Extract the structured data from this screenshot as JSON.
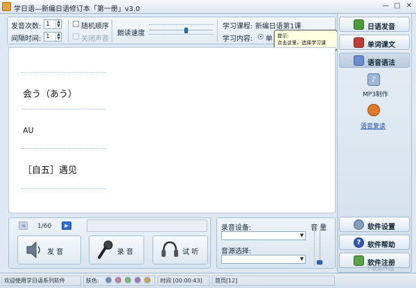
{
  "window": {
    "title": "学日语—新编日语修订本「第一册」v3.0",
    "minimize": "—",
    "maximize": "□",
    "close": "✕"
  },
  "settings": {
    "repeat_label": "发音次数:",
    "repeat_value": "1",
    "interval_label": "间隔时间:",
    "interval_value": "1",
    "random_label": "随机顺序",
    "mute_label": "关闭声音",
    "speed_label": "朗读速度",
    "speed_level": 0.55,
    "course_label": "学习课程:",
    "course_value": "新编日语第1课",
    "content_label": "学习内容:",
    "content_value": "单"
  },
  "tooltip": {
    "title": "提示:",
    "body": "点击这里，选择学习课程！"
  },
  "word": {
    "kana": "会う（あう）",
    "romaji": "AU",
    "meaning": "［自五］遇见"
  },
  "player": {
    "counter": "1/60",
    "speak_label": "发 音",
    "record_label": "录 音",
    "listen_label": "试 听"
  },
  "audio": {
    "device_label": "录音设备:",
    "source_label": "音源选择:",
    "volume_label": "音 量",
    "volume_level": 0.05
  },
  "sidebar": {
    "items": [
      {
        "label": "日语发音"
      },
      {
        "label": "单词课文"
      },
      {
        "label": "语音语法"
      }
    ],
    "mp3_label": "MP3制作",
    "review_label": "语音复读",
    "settings_label": "软件设置",
    "help_label": "软件帮助",
    "register_label": "软件注册"
  },
  "status": {
    "welcome": "欢迎使用学日语系列软件",
    "skin_label": "肤色:",
    "skin_colors": [
      "#6a8fc8",
      "#d27bb0",
      "#7fbf6a",
      "#a86fc9",
      "#e0a83a"
    ],
    "time": "时间 [00:00:43]",
    "page": "首页[12]"
  },
  "watermark": "下载软件园"
}
